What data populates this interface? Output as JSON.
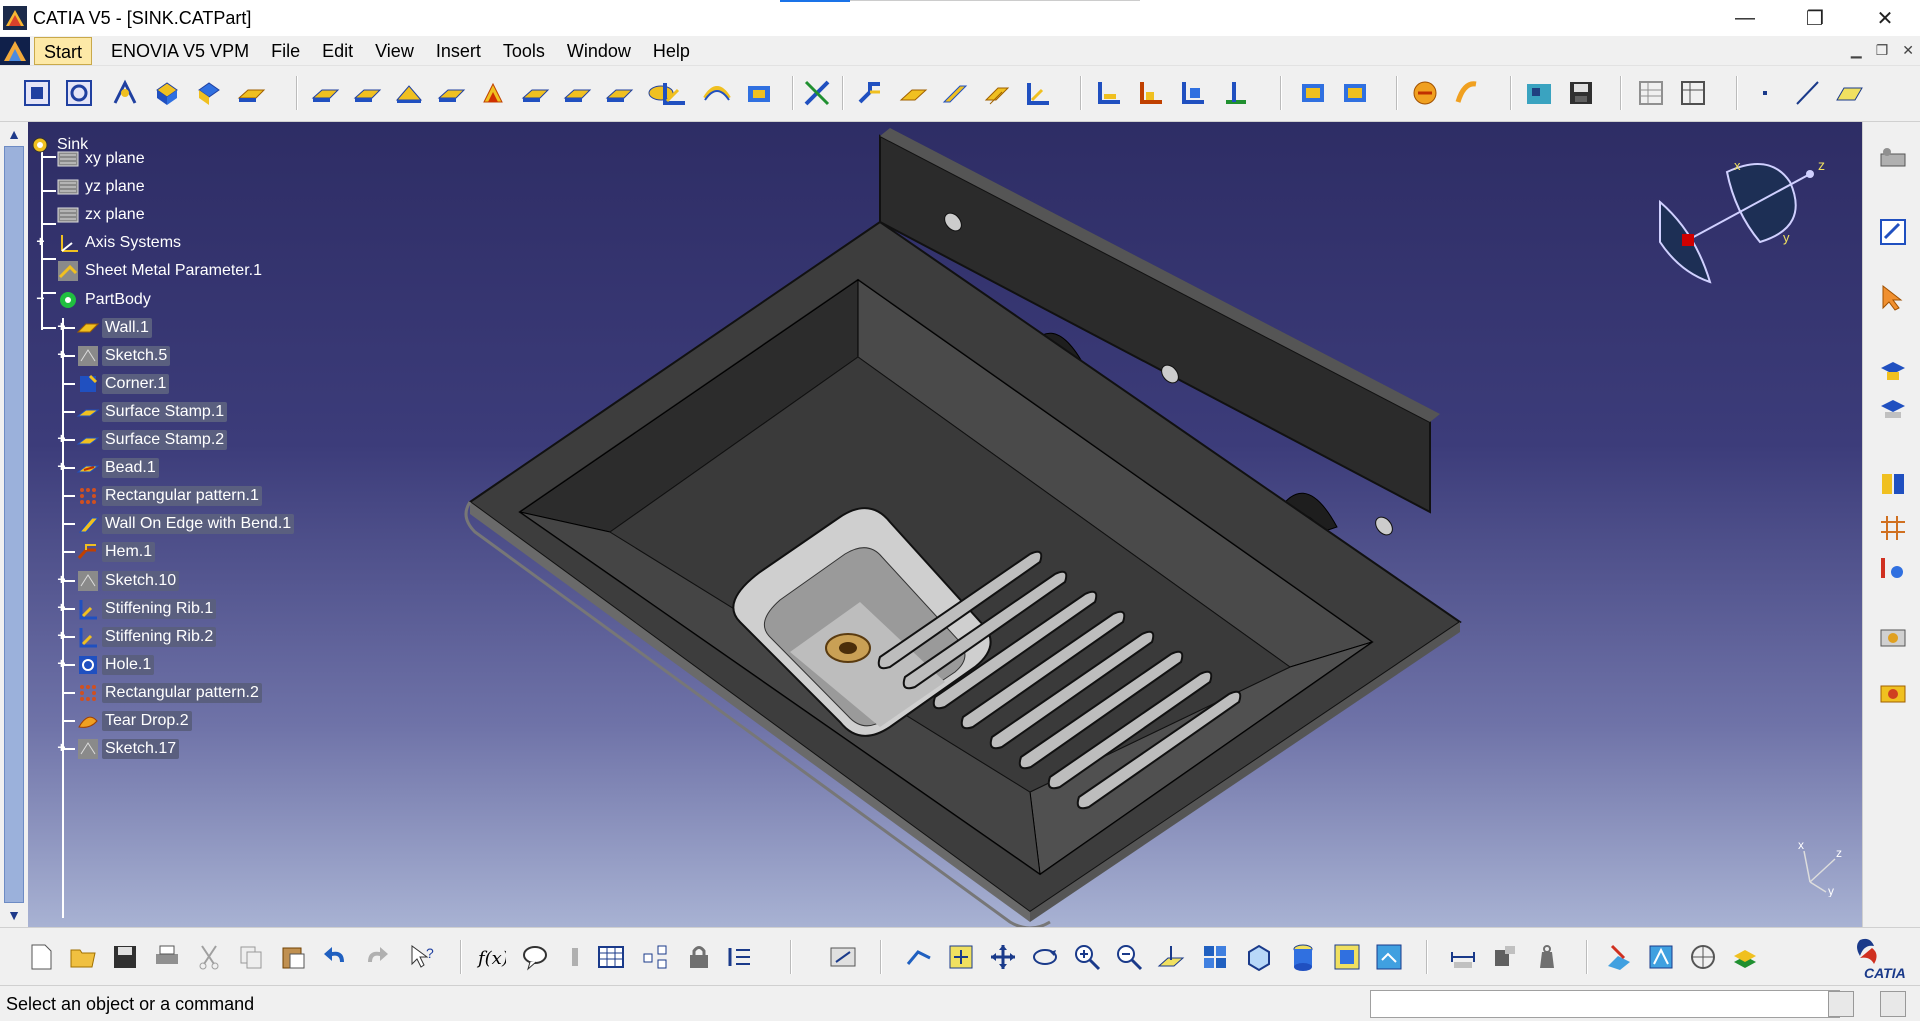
{
  "window": {
    "title": "CATIA V5 - [SINK.CATPart]",
    "minimize": "—",
    "restore": "❐",
    "close": "✕"
  },
  "menu": {
    "items": [
      "Start",
      "ENOVIA V5 VPM",
      "File",
      "Edit",
      "View",
      "Insert",
      "Tools",
      "Window",
      "Help"
    ]
  },
  "tree": {
    "root": "Sink",
    "nodes": [
      {
        "label": "xy plane",
        "icon": "plane-icon"
      },
      {
        "label": "yz plane",
        "icon": "plane-icon"
      },
      {
        "label": "zx plane",
        "icon": "plane-icon"
      },
      {
        "label": "Axis Systems",
        "icon": "axis-system-icon"
      },
      {
        "label": "Sheet Metal Parameter.1",
        "icon": "sheet-metal-parameter-icon"
      },
      {
        "label": "PartBody",
        "icon": "partbody-icon"
      },
      {
        "label": "Wall.1",
        "icon": "wall-icon"
      },
      {
        "label": "Sketch.5",
        "icon": "sketch-icon"
      },
      {
        "label": "Corner.1",
        "icon": "corner-icon"
      },
      {
        "label": "Surface Stamp.1",
        "icon": "surface-stamp-icon"
      },
      {
        "label": "Surface Stamp.2",
        "icon": "surface-stamp-icon"
      },
      {
        "label": "Bead.1",
        "icon": "bead-icon"
      },
      {
        "label": "Rectangular pattern.1",
        "icon": "rectangular-pattern-icon"
      },
      {
        "label": "Wall On Edge with Bend.1",
        "icon": "wall-on-edge-icon"
      },
      {
        "label": "Hem.1",
        "icon": "hem-icon"
      },
      {
        "label": "Sketch.10",
        "icon": "sketch-icon"
      },
      {
        "label": "Stiffening Rib.1",
        "icon": "stiffening-rib-icon"
      },
      {
        "label": "Stiffening Rib.2",
        "icon": "stiffening-rib-icon"
      },
      {
        "label": "Hole.1",
        "icon": "hole-icon"
      },
      {
        "label": "Rectangular pattern.2",
        "icon": "rectangular-pattern-icon"
      },
      {
        "label": "Tear Drop.2",
        "icon": "tear-drop-icon"
      },
      {
        "label": "Sketch.17",
        "icon": "sketch-icon"
      }
    ]
  },
  "compass": {
    "x": "x",
    "y": "y",
    "z": "z"
  },
  "axis_triad": {
    "x": "x",
    "y": "y",
    "z": "z"
  },
  "status": {
    "message": "Select an object or a command"
  },
  "brand": {
    "logo_text": "CATIA"
  },
  "colors": {
    "viewport_top": "#2e2d65",
    "viewport_bottom": "#a8b2d3",
    "selection": "#5a5f7f",
    "part": "#3a3a3a"
  }
}
